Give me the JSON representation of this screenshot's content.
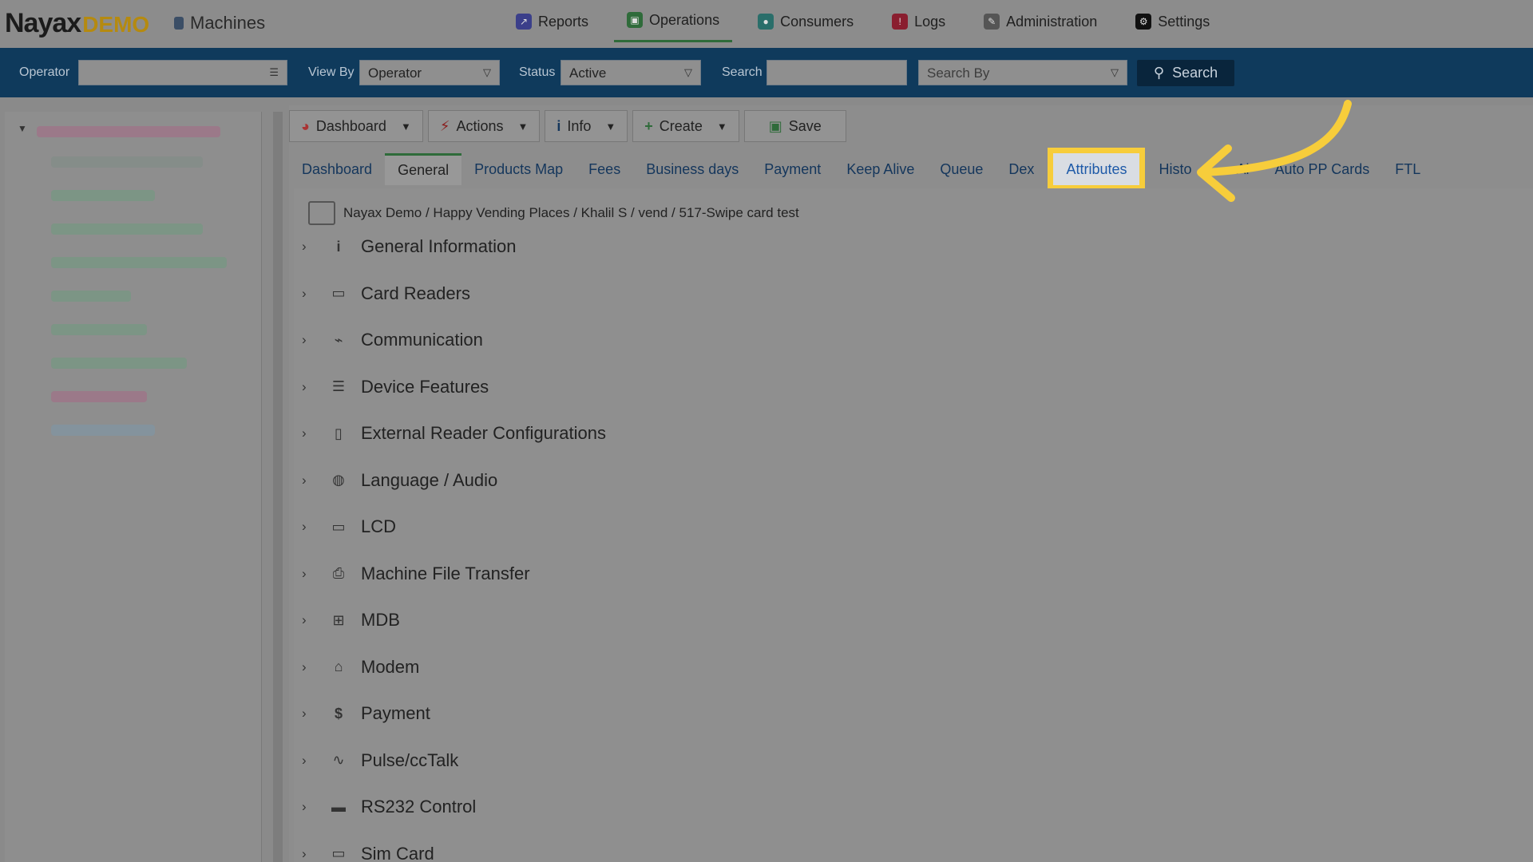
{
  "brand": {
    "name": "Nayax",
    "suffix": "DEMO",
    "page": "Machines"
  },
  "nav": [
    {
      "label": "Reports",
      "icon": "chart-icon",
      "color": "#3b3f8a",
      "glyph": "↗"
    },
    {
      "label": "Operations",
      "icon": "operations-icon",
      "color": "#2f6b3a",
      "glyph": "▣",
      "active": true
    },
    {
      "label": "Consumers",
      "icon": "consumers-icon",
      "color": "#2a6e6a",
      "glyph": "●"
    },
    {
      "label": "Logs",
      "icon": "logs-icon",
      "color": "#8a1e2f",
      "glyph": "!"
    },
    {
      "label": "Administration",
      "icon": "admin-icon",
      "color": "#555",
      "glyph": "✎"
    },
    {
      "label": "Settings",
      "icon": "settings-icon",
      "color": "#111",
      "glyph": "⚙"
    }
  ],
  "filters": {
    "operator_label": "Operator",
    "operator_value": "",
    "viewby_label": "View By",
    "viewby_value": "Operator",
    "status_label": "Status",
    "status_value": "Active",
    "search_label": "Search",
    "search_value": "",
    "searchby_placeholder": "Search By",
    "search_button": "Search"
  },
  "toolbar": {
    "dashboard": "Dashboard",
    "actions": "Actions",
    "info": "Info",
    "create": "Create",
    "save": "Save"
  },
  "tabs": [
    "Dashboard",
    "General",
    "Products Map",
    "Fees",
    "Business days",
    "Payment",
    "Keep Alive",
    "Queue",
    "Dex",
    "Attributes",
    "Histo",
    "Al",
    "Auto PP Cards",
    "FTL"
  ],
  "active_tab": "General",
  "highlighted_tab": "Attributes",
  "breadcrumb": "Nayax Demo / Happy Vending Places / Khalil S / vend / 517-Swipe card test",
  "sections": [
    {
      "label": "General Information",
      "icon": "info-icon",
      "glyph": "ℹ"
    },
    {
      "label": "Card Readers",
      "icon": "card-reader-icon",
      "glyph": "▭"
    },
    {
      "label": "Communication",
      "icon": "antenna-icon",
      "glyph": "⌁"
    },
    {
      "label": "Device Features",
      "icon": "list-icon",
      "glyph": "☰"
    },
    {
      "label": "External Reader Configurations",
      "icon": "external-reader-icon",
      "glyph": "▯"
    },
    {
      "label": "Language / Audio",
      "icon": "globe-icon",
      "glyph": "◍"
    },
    {
      "label": "LCD",
      "icon": "lcd-icon",
      "glyph": "▭"
    },
    {
      "label": "Machine File Transfer",
      "icon": "ftp-icon",
      "glyph": "⎙"
    },
    {
      "label": "MDB",
      "icon": "mdb-icon",
      "glyph": "⊞"
    },
    {
      "label": "Modem",
      "icon": "modem-icon",
      "glyph": "⌂"
    },
    {
      "label": "Payment",
      "icon": "dollar-icon",
      "glyph": "$"
    },
    {
      "label": "Pulse/ccTalk",
      "icon": "pulse-icon",
      "glyph": "∿"
    },
    {
      "label": "RS232 Control",
      "icon": "rs232-icon",
      "glyph": "▬"
    },
    {
      "label": "Sim Card",
      "icon": "sim-icon",
      "glyph": "▭"
    }
  ],
  "colors": {
    "accent_yellow": "#f7cd3b",
    "filter_bar": "#0f3a5c",
    "link_blue": "#14365c"
  }
}
